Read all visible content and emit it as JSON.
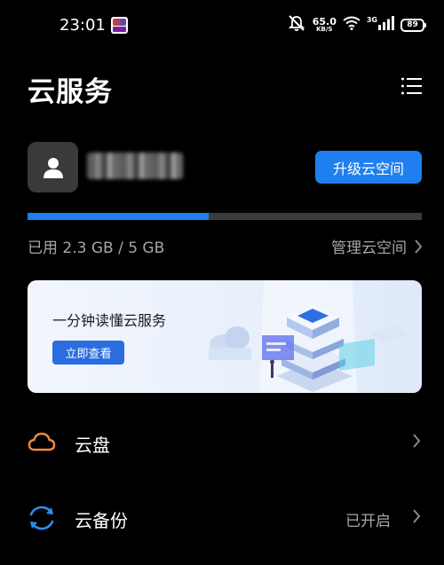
{
  "status_bar": {
    "time": "23:01",
    "app_icon": "app-notification-icon",
    "speed_value": "65.0",
    "speed_unit": "KB/S",
    "network_type": "3G",
    "battery": "89",
    "icons": [
      "mute-icon",
      "wifi-icon",
      "cellular-signal-icon",
      "battery-icon"
    ]
  },
  "header": {
    "title": "云服务",
    "menu_icon": "list-menu-icon"
  },
  "account": {
    "avatar_icon": "user-avatar-icon",
    "name": "",
    "upgrade_label": "升级云空间"
  },
  "storage": {
    "used_fraction": 0.46,
    "used_text": "已用 2.3 GB / 5 GB",
    "manage_label": "管理云空间",
    "manage_icon": "chevron-right-icon"
  },
  "banner": {
    "title": "一分钟读懂云服务",
    "button_label": "立即查看",
    "illustration": "cloud-server-illustration"
  },
  "list": [
    {
      "label": "云盘",
      "status": "",
      "icon": "cloud-drive-icon"
    },
    {
      "label": "云备份",
      "status": "已开启",
      "icon": "cloud-backup-icon"
    }
  ],
  "colors": {
    "background": "#000000",
    "accent": "#1f7ff0",
    "secondary_text": "#a6a6a6",
    "cloud_drive_icon": "#f08a3c",
    "backup_icon": "#2f8df0"
  }
}
